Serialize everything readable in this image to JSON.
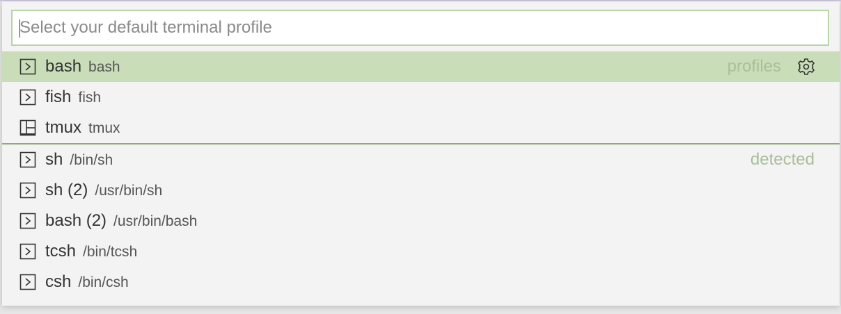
{
  "quick_pick": {
    "input": {
      "value": "",
      "placeholder": "Select your default terminal profile"
    },
    "groups": [
      {
        "group_label": "profiles",
        "items": [
          {
            "label": "bash",
            "description": "bash",
            "icon": "terminal-icon",
            "selected": true
          },
          {
            "label": "fish",
            "description": "fish",
            "icon": "terminal-icon",
            "selected": false
          },
          {
            "label": "tmux",
            "description": "tmux",
            "icon": "layout-icon",
            "selected": false
          }
        ]
      },
      {
        "group_label": "detected",
        "items": [
          {
            "label": "sh",
            "description": "/bin/sh",
            "icon": "terminal-icon"
          },
          {
            "label": "sh (2)",
            "description": "/usr/bin/sh",
            "icon": "terminal-icon"
          },
          {
            "label": "bash (2)",
            "description": "/usr/bin/bash",
            "icon": "terminal-icon"
          },
          {
            "label": "tcsh",
            "description": "/bin/tcsh",
            "icon": "terminal-icon"
          },
          {
            "label": "csh",
            "description": "/bin/csh",
            "icon": "terminal-icon"
          }
        ]
      }
    ],
    "configure_button_icon": "gear-icon",
    "colors": {
      "selection_background": "#c9deb8",
      "input_border": "#b7d4a8",
      "group_separator": "#8aac77",
      "group_label": "#a8bd99"
    }
  }
}
